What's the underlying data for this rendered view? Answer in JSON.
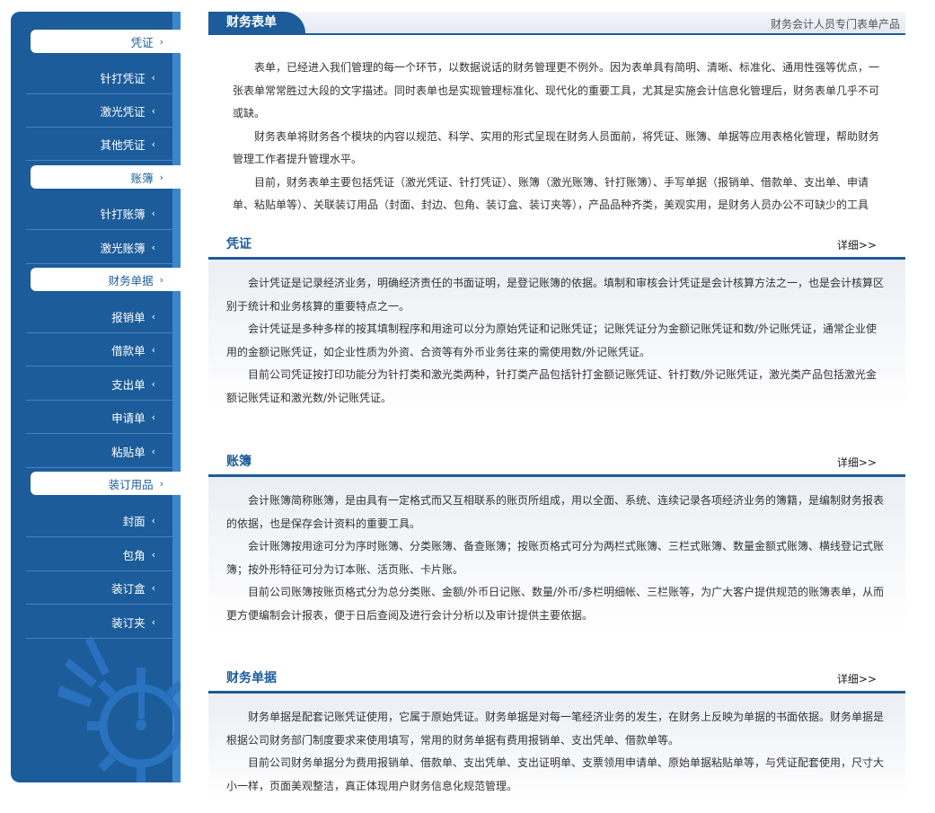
{
  "sidebar": {
    "items": [
      {
        "label": "凭证",
        "cat": true
      },
      {
        "label": "针打凭证",
        "cat": false
      },
      {
        "label": "激光凭证",
        "cat": false
      },
      {
        "label": "其他凭证",
        "cat": false
      },
      {
        "label": "账簿",
        "cat": true
      },
      {
        "label": "针打账簿",
        "cat": false
      },
      {
        "label": "激光账簿",
        "cat": false
      },
      {
        "label": "财务单据",
        "cat": true
      },
      {
        "label": "报销单",
        "cat": false
      },
      {
        "label": "借款单",
        "cat": false
      },
      {
        "label": "支出单",
        "cat": false
      },
      {
        "label": "申请单",
        "cat": false
      },
      {
        "label": "粘贴单",
        "cat": false
      },
      {
        "label": "装订用品",
        "cat": true
      },
      {
        "label": "封面",
        "cat": false
      },
      {
        "label": "包角",
        "cat": false
      },
      {
        "label": "装订盒",
        "cat": false
      },
      {
        "label": "装订夹",
        "cat": false
      }
    ],
    "arrow_cat": "›",
    "arrow_sub": "‹"
  },
  "header": {
    "title": "财务表单",
    "subtitle": "财务会计人员专门表单产品"
  },
  "intro": {
    "paragraphs": [
      "表单，已经进入我们管理的每一个环节，以数据说话的财务管理更不例外。因为表单具有简明、清晰、标准化、通用性强等优点，一张表单常常胜过大段的文字描述。同时表单也是实现管理标准化、现代化的重要工具，尤其是实施会计信息化管理后，财务表单几乎不可或缺。",
      "财务表单将财务各个模块的内容以规范、科学、实用的形式呈现在财务人员面前，将凭证、账簿、单据等应用表格化管理，帮助财务管理工作者提升管理水平。",
      "目前，财务表单主要包括凭证（激光凭证、针打凭证）、账簿（激光账簿、针打账簿）、手写单据（报销单、借款单、支出单、申请单、粘贴单等）、关联装订用品（封面、封边、包角、装订盒、装订夹等），产品品种齐类，美观实用，是财务人员办公不可缺少的工具"
    ]
  },
  "sections": [
    {
      "title": "凭证",
      "more": "详细>>",
      "paragraphs": [
        "会计凭证是记录经济业务，明确经济责任的书面证明，是登记账簿的依据。填制和审核会计凭证是会计核算方法之一，也是会计核算区别于统计和业务核算的重要特点之一。",
        "会计凭证是多种多样的按其填制程序和用途可以分为原始凭证和记账凭证；记账凭证分为金额记账凭证和数/外记账凭证，通常企业使用的金额记账凭证，如企业性质为外资、合资等有外币业务往来的需使用数/外记账凭证。",
        "目前公司凭证按打印功能分为针打类和激光类两种，针打类产品包括针打金额记账凭证、针打数/外记账凭证，激光类产品包括激光金额记账凭证和激光数/外记账凭证。"
      ]
    },
    {
      "title": "账簿",
      "more": "详细>>",
      "paragraphs": [
        "会计账簿简称账簿，是由具有一定格式而又互相联系的账页所组成，用以全面、系统、连续记录各项经济业务的簿籍，是编制财务报表的依据，也是保存会计资料的重要工具。",
        "会计账簿按用途可分为序时账簿、分类账簿、备查账簿；按账页格式可分为两栏式账簿、三栏式账簿、数量金额式账簿、横线登记式账簿；按外形特征可分为订本账、活页账、卡片账。",
        "目前公司账簿按账页格式分为总分类账、金额/外币日记账、数量/外币/多栏明细帐、三栏账等，为广大客户提供规范的账簿表单，从而更方便编制会计报表，便于日后查阅及进行会计分析以及审计提供主要依据。"
      ]
    },
    {
      "title": "财务单据",
      "more": "详细>>",
      "paragraphs": [
        "财务单据是配套记账凭证使用，它属于原始凭证。财务单据是对每一笔经济业务的发生，在财务上反映为单据的书面依据。财务单据是根据公司财务部门制度要求来使用填写，常用的财务单据有费用报销单、支出凭单、借款单等。",
        "目前公司财务单据分为费用报销单、借款单、支出凭单、支出证明单、支票领用申请单、原始单据粘贴单等，与凭证配套使用，尺寸大小一样，页面美观整洁，真正体现用户财务信息化规范管理。"
      ]
    }
  ]
}
